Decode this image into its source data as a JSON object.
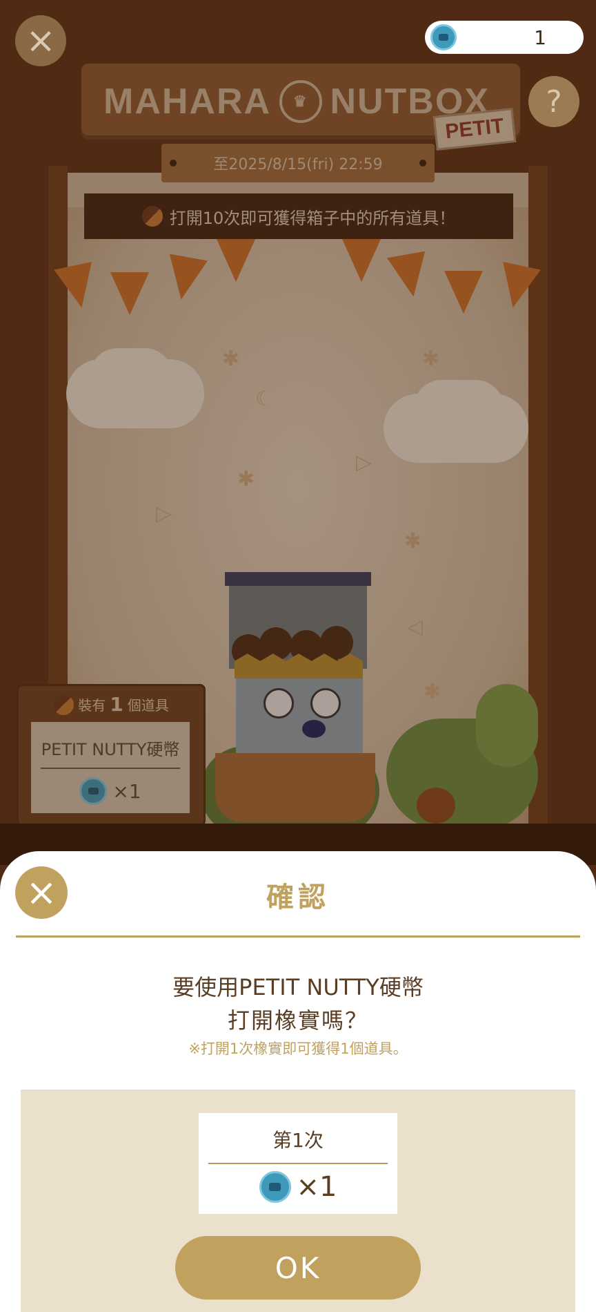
{
  "header": {
    "close_icon": "close-icon",
    "coin_count": "1",
    "help_label": "?"
  },
  "banner": {
    "logo_left": "MAHARA",
    "logo_right": "NUTBOX",
    "logo_tag": "PETIT",
    "date_text": "至2025/8/15(fri) 22:59",
    "info_text": "打開10次即可獲得箱子中的所有道具！"
  },
  "contents_sign": {
    "prefix": "裝有",
    "count": "1",
    "suffix": "個道具",
    "item_name": "PETIT NUTTY硬幣",
    "item_qty": "×1"
  },
  "modal": {
    "title": "確認",
    "question_line1": "要使用PETIT NUTTY硬幣",
    "question_line2": "打開橡實嗎？",
    "note": "※打開1次橡實即可獲得1個道具。",
    "card_title": "第1次",
    "card_qty": "×1",
    "ok_label": "OK"
  },
  "colors": {
    "accent_gold": "#c0a25e",
    "modal_panel": "#ebe0cc",
    "text_brown": "#5a3e24",
    "coin_blue": "#3e9ab8"
  }
}
